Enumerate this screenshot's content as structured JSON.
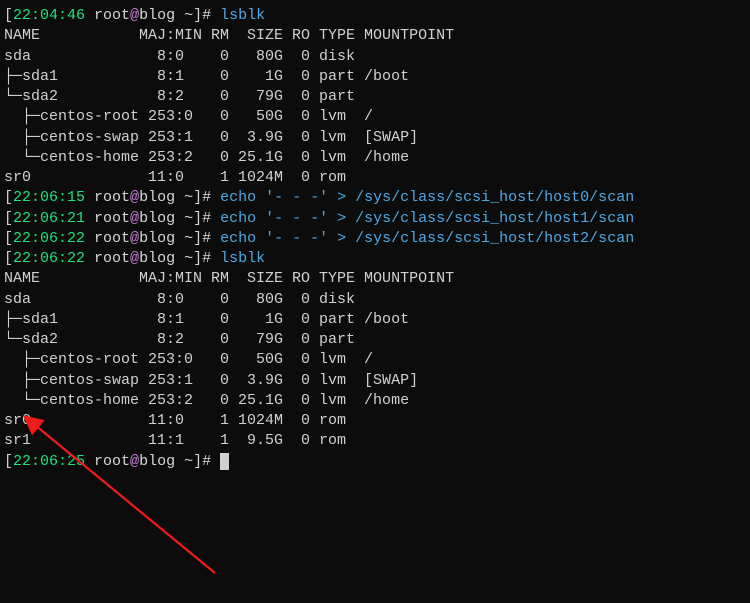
{
  "lines": [
    {
      "type": "prompt",
      "time": "22:04:46",
      "user": "root",
      "host": "blog",
      "path": "~",
      "cmd": "lsblk"
    },
    {
      "type": "out",
      "text": "NAME           MAJ:MIN RM  SIZE RO TYPE MOUNTPOINT"
    },
    {
      "type": "out",
      "text": "sda              8:0    0   80G  0 disk "
    },
    {
      "type": "out",
      "text": "├─sda1           8:1    0    1G  0 part /boot"
    },
    {
      "type": "out",
      "text": "└─sda2           8:2    0   79G  0 part "
    },
    {
      "type": "out",
      "text": "  ├─centos-root 253:0   0   50G  0 lvm  /"
    },
    {
      "type": "out",
      "text": "  ├─centos-swap 253:1   0  3.9G  0 lvm  [SWAP]"
    },
    {
      "type": "out",
      "text": "  └─centos-home 253:2   0 25.1G  0 lvm  /home"
    },
    {
      "type": "out",
      "text": "sr0             11:0    1 1024M  0 rom  "
    },
    {
      "type": "prompt",
      "time": "22:06:15",
      "user": "root",
      "host": "blog",
      "path": "~",
      "cmd": "echo '- - -' > /sys/class/scsi_host/host0/scan"
    },
    {
      "type": "prompt",
      "time": "22:06:21",
      "user": "root",
      "host": "blog",
      "path": "~",
      "cmd": "echo '- - -' > /sys/class/scsi_host/host1/scan"
    },
    {
      "type": "prompt",
      "time": "22:06:22",
      "user": "root",
      "host": "blog",
      "path": "~",
      "cmd": "echo '- - -' > /sys/class/scsi_host/host2/scan"
    },
    {
      "type": "prompt",
      "time": "22:06:22",
      "user": "root",
      "host": "blog",
      "path": "~",
      "cmd": "lsblk"
    },
    {
      "type": "out",
      "text": "NAME           MAJ:MIN RM  SIZE RO TYPE MOUNTPOINT"
    },
    {
      "type": "out",
      "text": "sda              8:0    0   80G  0 disk "
    },
    {
      "type": "out",
      "text": "├─sda1           8:1    0    1G  0 part /boot"
    },
    {
      "type": "out",
      "text": "└─sda2           8:2    0   79G  0 part "
    },
    {
      "type": "out",
      "text": "  ├─centos-root 253:0   0   50G  0 lvm  /"
    },
    {
      "type": "out",
      "text": "  ├─centos-swap 253:1   0  3.9G  0 lvm  [SWAP]"
    },
    {
      "type": "out",
      "text": "  └─centos-home 253:2   0 25.1G  0 lvm  /home"
    },
    {
      "type": "out",
      "text": "sr0             11:0    1 1024M  0 rom  "
    },
    {
      "type": "out",
      "text": "sr1             11:1    1  9.5G  0 rom  "
    },
    {
      "type": "prompt",
      "time": "22:06:25",
      "user": "root",
      "host": "blog",
      "path": "~",
      "cmd": "",
      "cursor": true
    }
  ],
  "colors": {
    "time": "#1fe07a",
    "at": "#c87cd8",
    "cmd": "#4ea9e6",
    "arrow": "#f11b1b"
  }
}
